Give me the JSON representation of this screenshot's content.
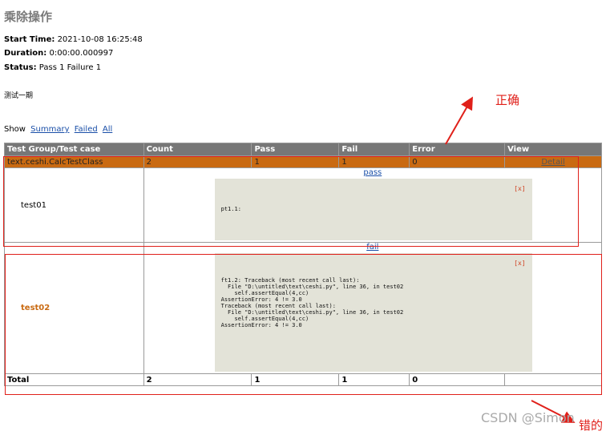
{
  "report": {
    "title": "乘除操作",
    "start_time_label": "Start Time:",
    "start_time": "2021-10-08 16:25:48",
    "duration_label": "Duration:",
    "duration": "0:00:00.000997",
    "status_label": "Status:",
    "status": "Pass 1 Failure 1",
    "description": "测试一期"
  },
  "filter": {
    "label": "Show",
    "summary": "Summary",
    "failed": "Failed",
    "all": "All"
  },
  "table": {
    "headers": [
      "Test Group/Test case",
      "Count",
      "Pass",
      "Fail",
      "Error",
      "View"
    ],
    "class_row": {
      "name": "text.ceshi.CalcTestClass",
      "count": "2",
      "pass": "1",
      "fail": "1",
      "error": "0",
      "view": "Detail"
    },
    "case1": {
      "name": "test01",
      "link": "pass",
      "close": "[x]",
      "output": "pt1.1:"
    },
    "case2": {
      "name": "test02",
      "link": "fail",
      "close": "[x]",
      "output": "ft1.2: Traceback (most recent call last):\n  File \"D:\\untitled\\text\\ceshi.py\", line 36, in test02\n    self.assertEqual(4,cc)\nAssertionError: 4 != 3.0\nTraceback (most recent call last):\n  File \"D:\\untitled\\text\\ceshi.py\", line 36, in test02\n    self.assertEqual(4,cc)\nAssertionError: 4 != 3.0"
    },
    "total": {
      "label": "Total",
      "count": "2",
      "pass": "1",
      "fail": "1",
      "error": "0"
    }
  },
  "annotations": {
    "correct": "正确",
    "wrong": "错的",
    "color": "#e0201a"
  },
  "watermark": "CSDN @Simon"
}
